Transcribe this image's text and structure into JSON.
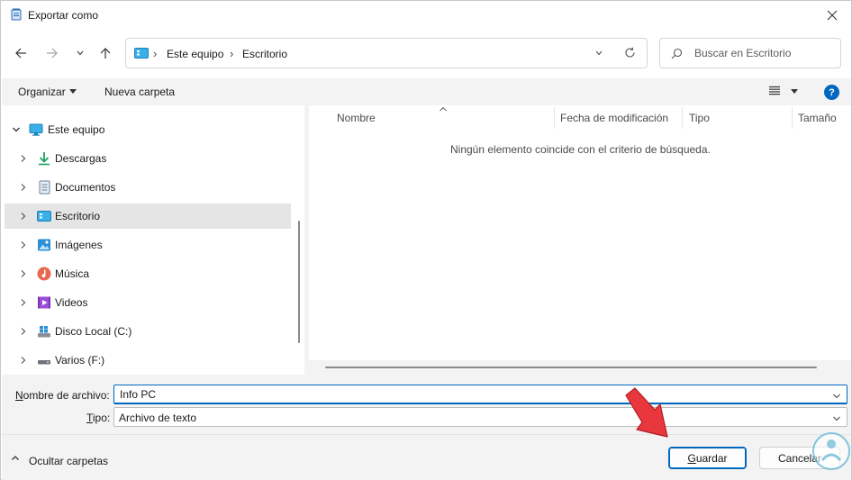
{
  "window": {
    "title": "Exportar como",
    "icon": "notepad-icon"
  },
  "nav": {
    "back_icon": "arrow-left-icon",
    "forward_icon": "arrow-right-icon",
    "recent_icon": "chevron-down-icon",
    "up_icon": "arrow-up-icon"
  },
  "address": {
    "root_icon": "desktop-folder-icon",
    "crumbs": [
      "Este equipo",
      "Escritorio"
    ]
  },
  "search": {
    "placeholder": "Buscar en Escritorio"
  },
  "commands": {
    "organize": "Organizar",
    "new_folder": "Nueva carpeta",
    "help": "?"
  },
  "sidebar": {
    "root": {
      "label": "Este equipo",
      "icon": "computer-icon",
      "expanded": true
    },
    "items": [
      {
        "label": "Descargas",
        "icon": "download-icon"
      },
      {
        "label": "Documentos",
        "icon": "documents-icon"
      },
      {
        "label": "Escritorio",
        "icon": "desktop-folder-icon",
        "selected": true
      },
      {
        "label": "Imágenes",
        "icon": "pictures-icon"
      },
      {
        "label": "Música",
        "icon": "music-icon"
      },
      {
        "label": "Videos",
        "icon": "videos-icon"
      },
      {
        "label": "Disco Local (C:)",
        "icon": "windows-drive-icon"
      },
      {
        "label": "Varios (F:)",
        "icon": "drive-icon"
      }
    ]
  },
  "columns": [
    "Nombre",
    "Fecha de modificación",
    "Tipo",
    "Tamaño"
  ],
  "empty_message": "Ningún elemento coincide con el criterio de búsqueda.",
  "form": {
    "filename_label": "Nombre de archivo:",
    "filename_value": "Info PC",
    "type_label": "Tipo:",
    "type_value": "Archivo de texto"
  },
  "footer": {
    "hide_folders": "Ocultar carpetas",
    "save": "Guardar",
    "cancel": "Cancelar"
  },
  "colors": {
    "accent": "#0067c0",
    "annotation_arrow": "#e8383d"
  }
}
